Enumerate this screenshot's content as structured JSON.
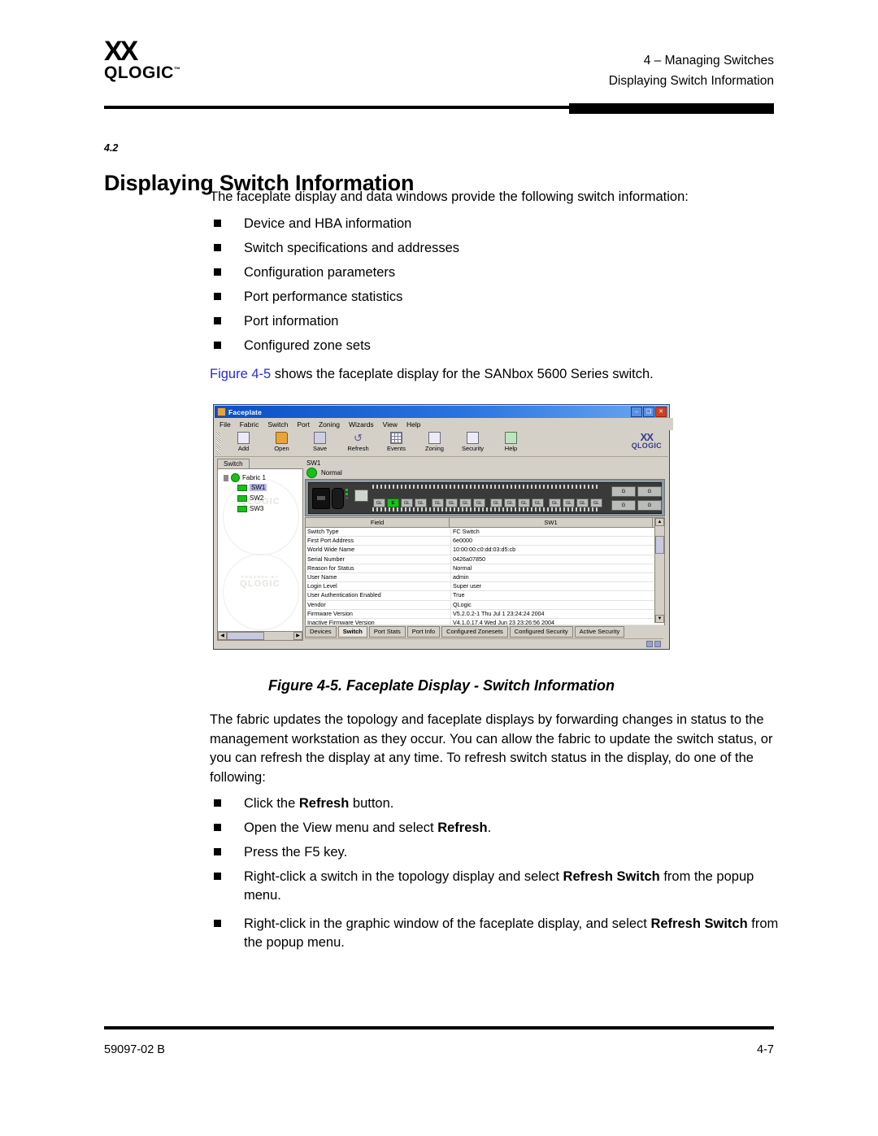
{
  "header": {
    "logo_mark": "ΧΧ",
    "logo_word": "QLOGIC",
    "logo_tm": "™",
    "chapter": "4 – Managing Switches",
    "section_running_head": "Displaying Switch Information"
  },
  "section": {
    "number": "4.2",
    "title": "Displaying Switch Information",
    "intro": "The faceplate display and data windows provide the following switch information:",
    "bullets": [
      "Device and HBA information",
      "Switch specifications and addresses",
      "Configuration parameters",
      "Port performance statistics",
      "Port information",
      "Configured zone sets"
    ],
    "figure_ref_link": "Figure 4-5",
    "figure_ref_rest": " shows the faceplate display for the SANbox 5600 Series switch."
  },
  "figure": {
    "caption": "Figure 4-5.  Faceplate Display - Switch Information",
    "window": {
      "title": "Faceplate",
      "titlebar_icon": "app-icon",
      "buttons": {
        "minimize": "–",
        "maximize": "❑",
        "close": "✕"
      },
      "menu": [
        "File",
        "Fabric",
        "Switch",
        "Port",
        "Zoning",
        "Wizards",
        "View",
        "Help"
      ],
      "toolbar": [
        {
          "label": "Add",
          "icon": "add-icon"
        },
        {
          "label": "Open",
          "icon": "folder-open-icon"
        },
        {
          "label": "Save",
          "icon": "save-icon"
        },
        {
          "label": "Refresh",
          "icon": "refresh-icon"
        },
        {
          "label": "Events",
          "icon": "events-grid-icon"
        },
        {
          "label": "Zoning",
          "icon": "zoning-icon"
        },
        {
          "label": "Security",
          "icon": "security-icon"
        },
        {
          "label": "Help",
          "icon": "help-icon"
        }
      ],
      "toolbar_brand_mark": "ΧΧ",
      "toolbar_brand_word": "QLOGIC"
    },
    "tree": {
      "tab_label": "Switch",
      "root": "Fabric 1",
      "nodes": [
        "SW1",
        "SW2",
        "SW3"
      ],
      "selected": "SW1",
      "watermark_top": "QLOGIC",
      "watermark_sub": "POWERED BY",
      "watermark_bottom": "QLOGIC"
    },
    "panel": {
      "switch_name": "SW1",
      "status": "Normal",
      "port_buttons": [
        "GL",
        "E",
        "GL",
        "GL",
        "GL",
        "GL",
        "GL",
        "GL",
        "GL",
        "GL",
        "GL",
        "GL",
        "GL",
        "GL",
        "GL",
        "GL"
      ],
      "gbic_labels": [
        "G",
        "G",
        "G",
        "G"
      ]
    },
    "table": {
      "columns": [
        "Field",
        "SW1"
      ],
      "rows": [
        [
          "Switch Type",
          "FC Switch"
        ],
        [
          "First Port Address",
          "6e0000"
        ],
        [
          "World Wide Name",
          "10:00:00:c0:dd:03:d5:cb"
        ],
        [
          "Serial Number",
          "0426a07850"
        ],
        [
          "Reason for Status",
          "Normal"
        ],
        [
          "User Name",
          "admin"
        ],
        [
          "Login Level",
          "Super user"
        ],
        [
          "User Authentication Enabled",
          "True"
        ],
        [
          "Vendor",
          "QLogic"
        ],
        [
          "Firmware Version",
          "V5.2.0.2-1 Thu Jul 1 23:24:24 2004"
        ],
        [
          "Inactive Firmware Version",
          "V4.1.0.17.4 Wed Jun 23 23:26:56 2004"
        ]
      ]
    },
    "bottom_tabs": [
      "Devices",
      "Switch",
      "Port Stats",
      "Port Info",
      "Configured Zonesets",
      "Configured Security",
      "Active Security"
    ],
    "bottom_tab_selected": "Switch"
  },
  "after_figure": {
    "paragraph": "The fabric updates the topology and faceplate displays by forwarding changes in status to the management workstation as they occur. You can allow the fabric to update the switch status, or you can refresh the display at any time. To refresh switch status in the display, do one of the following:",
    "bullets": [
      {
        "pre": "Click the ",
        "bold": "Refresh",
        "post": " button."
      },
      {
        "pre": "Open the View menu and select ",
        "bold": "Refresh",
        "post": "."
      },
      {
        "pre": "Press the F5 key.",
        "bold": "",
        "post": ""
      },
      {
        "pre": "Right-click a switch in the topology display and select ",
        "bold": "Refresh Switch",
        "post": " from the popup menu."
      },
      {
        "pre": "Right-click in the graphic window of the faceplate display, and select ",
        "bold": "Refresh Switch",
        "post": " from the popup menu."
      }
    ]
  },
  "footer": {
    "left": "59097-02 B",
    "right": "4-7"
  },
  "colors": {
    "link": "#2a2ad0",
    "status_green": "#18c018",
    "titlebar_blue": "#0b4fc4",
    "window_gray": "#d4d0c8"
  }
}
